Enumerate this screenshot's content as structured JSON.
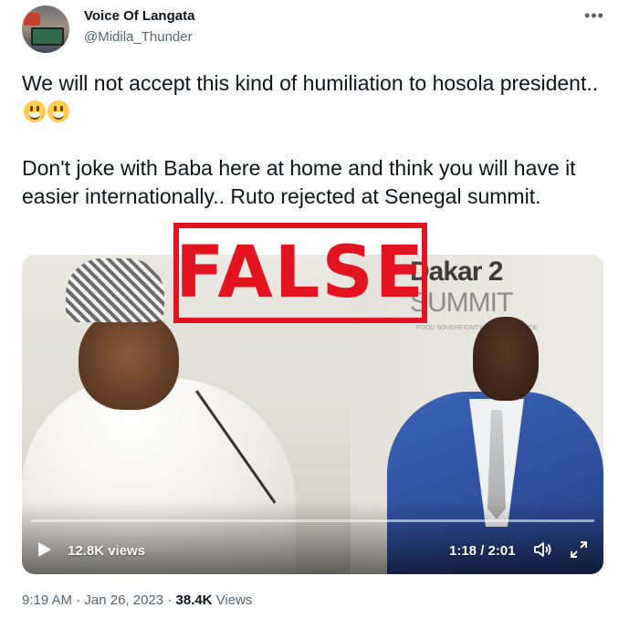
{
  "author": {
    "display_name": "Voice Of Langata",
    "handle": "@Midila_Thunder"
  },
  "more_icon": "more-horizontal-icon",
  "tweet": {
    "paragraph1": "We will not accept this kind of humiliation to hosola president..",
    "paragraph2": "Don't joke with Baba here at home and think you will have it easier internationally.. Ruto rejected at Senegal summit.",
    "emoji": "smiley-emoji"
  },
  "video": {
    "overlay_stamp": "FALSE",
    "views": "12.8K views",
    "time": "1:18 / 2:01",
    "background_text": {
      "line1": "Dakar 2",
      "line2": "SUMMIT",
      "small": "FOOD SOVEREIGNTY AND RESILIENCE",
      "stand": "2"
    },
    "icons": {
      "play": "play-icon",
      "volume": "volume-icon",
      "fullscreen": "fullscreen-icon"
    }
  },
  "meta": {
    "time": "9:19 AM",
    "date": "Jan 26, 2023",
    "views_count": "38.4K",
    "views_label": "Views",
    "separator": "·"
  },
  "colors": {
    "stamp_red": "#e3141f",
    "secondary_text": "#536471",
    "primary_text": "#0f1419"
  }
}
